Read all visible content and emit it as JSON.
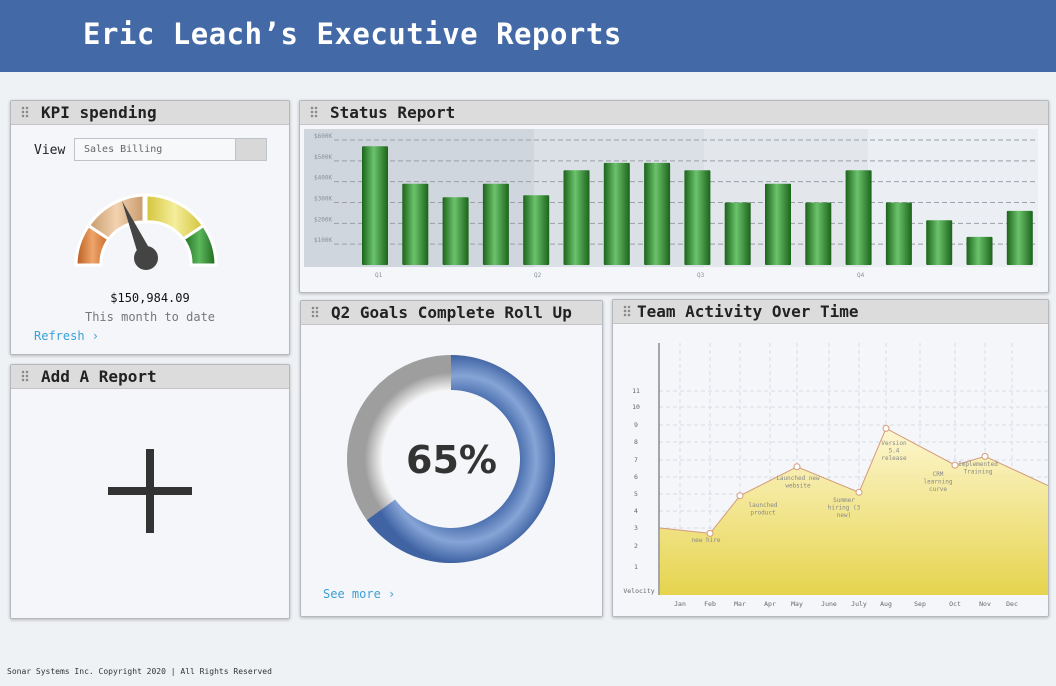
{
  "header": {
    "title": "Eric Leach’s Executive Reports"
  },
  "colors": {
    "header_bg": "#4369a6",
    "link": "#3aa0d8",
    "bar_green": "#2f8a2f",
    "donut_blue": "#5b7fbd",
    "area_yellow": "#e8d857"
  },
  "kpi": {
    "title": "KPI spending",
    "view_label": "View",
    "view_value": "Sales Billing",
    "amount": "$150,984.09",
    "caption": "This month to date",
    "refresh_label": "Refresh ›",
    "gauge_level": 0.4
  },
  "add_report": {
    "title": "Add A Report",
    "icon": "plus-icon"
  },
  "status": {
    "title": "Status Report",
    "chart_data": {
      "type": "bar",
      "ylim": [
        0,
        600
      ],
      "y_ticks": [
        "$600K",
        "$500K",
        "$400K",
        "$300K",
        "$200K",
        "$100K"
      ],
      "quarter_labels": [
        "Q1",
        "Q2",
        "Q3",
        "Q4"
      ],
      "values": [
        570,
        390,
        325,
        390,
        335,
        455,
        490,
        490,
        455,
        300,
        390,
        300,
        455,
        300,
        215,
        135,
        260
      ],
      "grid": true
    }
  },
  "q2": {
    "title": "Q2 Goals Complete Roll Up",
    "percent_label": "65%",
    "percent": 0.65,
    "see_more_label": "See more ›"
  },
  "team": {
    "title": "Team Activity Over Time",
    "chart_data": {
      "type": "area",
      "ylabel": "Velocity",
      "y_ticks": [
        "1",
        "2",
        "3",
        "4",
        "5",
        "6",
        "7",
        "8",
        "9",
        "10",
        "11"
      ],
      "months": [
        "Jan",
        "Feb",
        "Mar",
        "Apr",
        "May",
        "June",
        "July",
        "Aug",
        "Sep",
        "Oct",
        "Nov",
        "Dec"
      ],
      "points": [
        {
          "month": "Jan",
          "value": 3.0
        },
        {
          "month": "Feb",
          "value": 2.7
        },
        {
          "month": "Mar",
          "value": 4.9
        },
        {
          "month": "May",
          "value": 6.6
        },
        {
          "month": "July",
          "value": 5.1
        },
        {
          "month": "Aug",
          "value": 8.8
        },
        {
          "month": "Oct",
          "value": 6.7
        },
        {
          "month": "Nov",
          "value": 7.2
        },
        {
          "month": "Dec",
          "value": 5.5
        }
      ],
      "annotations": [
        {
          "text": "new hire",
          "month": "Feb"
        },
        {
          "text": "launched product",
          "month": "Mar"
        },
        {
          "text": "Launched new website",
          "month": "May"
        },
        {
          "text": "Summer hiring (3 new)",
          "month": "July"
        },
        {
          "text": "Version 5.4 release",
          "month": "Aug"
        },
        {
          "text": "CRM learning curve",
          "month": "Oct"
        },
        {
          "text": "Implemented Training",
          "month": "Nov"
        }
      ],
      "grid": true
    }
  },
  "footer": {
    "text": "Sonar Systems Inc. Copyright 2020 | All Rights Reserved"
  }
}
